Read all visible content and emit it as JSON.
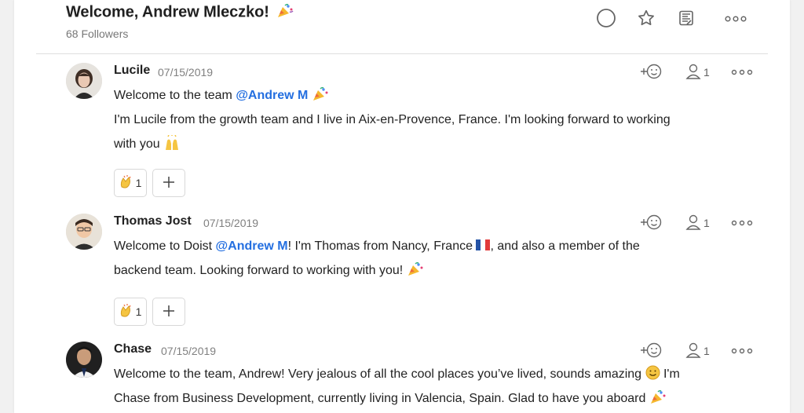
{
  "thread": {
    "title": "Welcome, Andrew Mleczko!",
    "title_emoji": "party-popper-icon",
    "followers": "68 Followers"
  },
  "header_actions": {
    "complete_label": "complete-circle-icon",
    "star_label": "star-icon",
    "notes_label": "notes-icon",
    "more_label": "more-icon"
  },
  "comments": [
    {
      "author": "Lucile",
      "date": "07/15/2019",
      "line1_before_mention": "Welcome to the team ",
      "mention": "@Andrew M",
      "line2": "I'm Lucile from the growth team and I live in Aix-en-Provence, France. I'm looking forward to working",
      "line3": "with you",
      "recipient_count": "1",
      "reaction_count": "1"
    },
    {
      "author": "Thomas Jost",
      "date": "07/15/2019",
      "line1_before_mention": "Welcome to Doist ",
      "mention": "@Andrew M",
      "line1_after_mention": "! I'm Thomas from Nancy, France ",
      "line1_after_flag": ", and also a member of the",
      "line2": "backend team. Looking forward to working with you! ",
      "recipient_count": "1",
      "reaction_count": "1"
    },
    {
      "author": "Chase",
      "date": "07/15/2019",
      "line1": "Welcome to the team, Andrew! Very jealous of all the cool places you’ve lived, sounds amazing ",
      "line1_after_emoji": " I'm",
      "line2": "Chase from Business Development, currently living in Valencia, Spain. Glad to have you aboard ",
      "recipient_count": "1"
    }
  ],
  "colors": {
    "mention": "#246fe0",
    "muted": "#808080",
    "border": "#d8d8d8"
  }
}
